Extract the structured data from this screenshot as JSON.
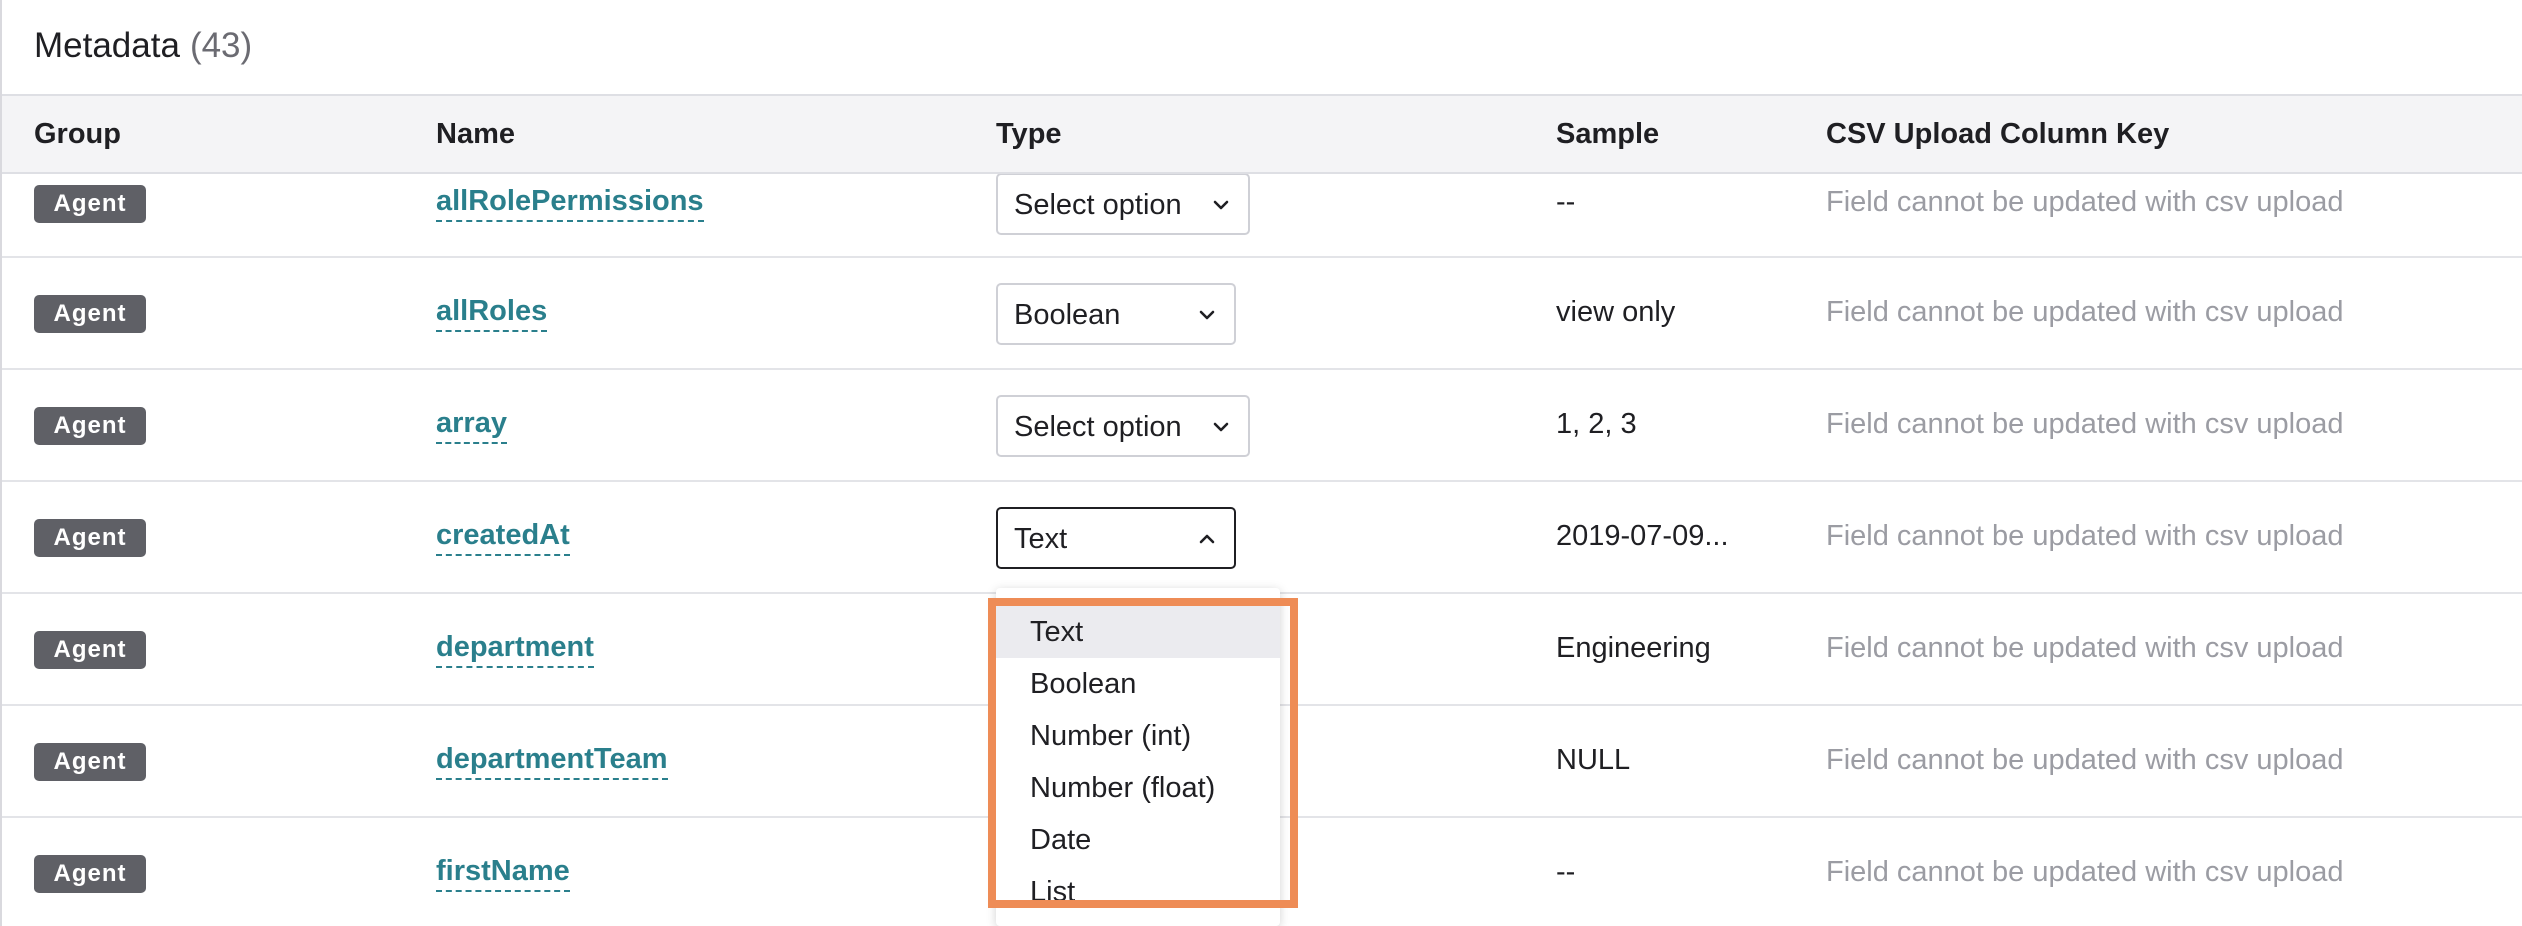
{
  "header": {
    "title": "Metadata",
    "count": "(43)"
  },
  "columns": {
    "group": "Group",
    "name": "Name",
    "type": "Type",
    "sample": "Sample",
    "csv": "CSV Upload Column Key"
  },
  "rows": [
    {
      "group": "Agent",
      "name": "allRolePermissions",
      "type": "Select option",
      "sample": "--",
      "csv": "Field cannot be updated with csv upload"
    },
    {
      "group": "Agent",
      "name": "allRoles",
      "type": "Boolean",
      "sample": "view only",
      "csv": "Field cannot be updated with csv upload"
    },
    {
      "group": "Agent",
      "name": "array",
      "type": "Select option",
      "sample": "1, 2, 3",
      "csv": "Field cannot be updated with csv upload"
    },
    {
      "group": "Agent",
      "name": "createdAt",
      "type": "Text",
      "sample": "2019-07-09...",
      "csv": "Field cannot be updated with csv upload"
    },
    {
      "group": "Agent",
      "name": "department",
      "type": "",
      "sample": "Engineering",
      "csv": "Field cannot be updated with csv upload"
    },
    {
      "group": "Agent",
      "name": "departmentTeam",
      "type": "",
      "sample": "NULL",
      "csv": "Field cannot be updated with csv upload"
    },
    {
      "group": "Agent",
      "name": "firstName",
      "type": "",
      "sample": "--",
      "csv": "Field cannot be updated with csv upload"
    }
  ],
  "dropdown": {
    "options": [
      "Text",
      "Boolean",
      "Number (int)",
      "Number (float)",
      "Date",
      "List"
    ],
    "selected": "Text"
  },
  "icons": {
    "chevron_down": "chevron-down-icon",
    "chevron_up": "chevron-up-icon"
  },
  "colors": {
    "badge_bg": "#5f6066",
    "link": "#2a7f8c",
    "highlight": "#ee8c56",
    "header_bg": "#f4f4f6",
    "placeholder_text": "#9b9ca3"
  }
}
